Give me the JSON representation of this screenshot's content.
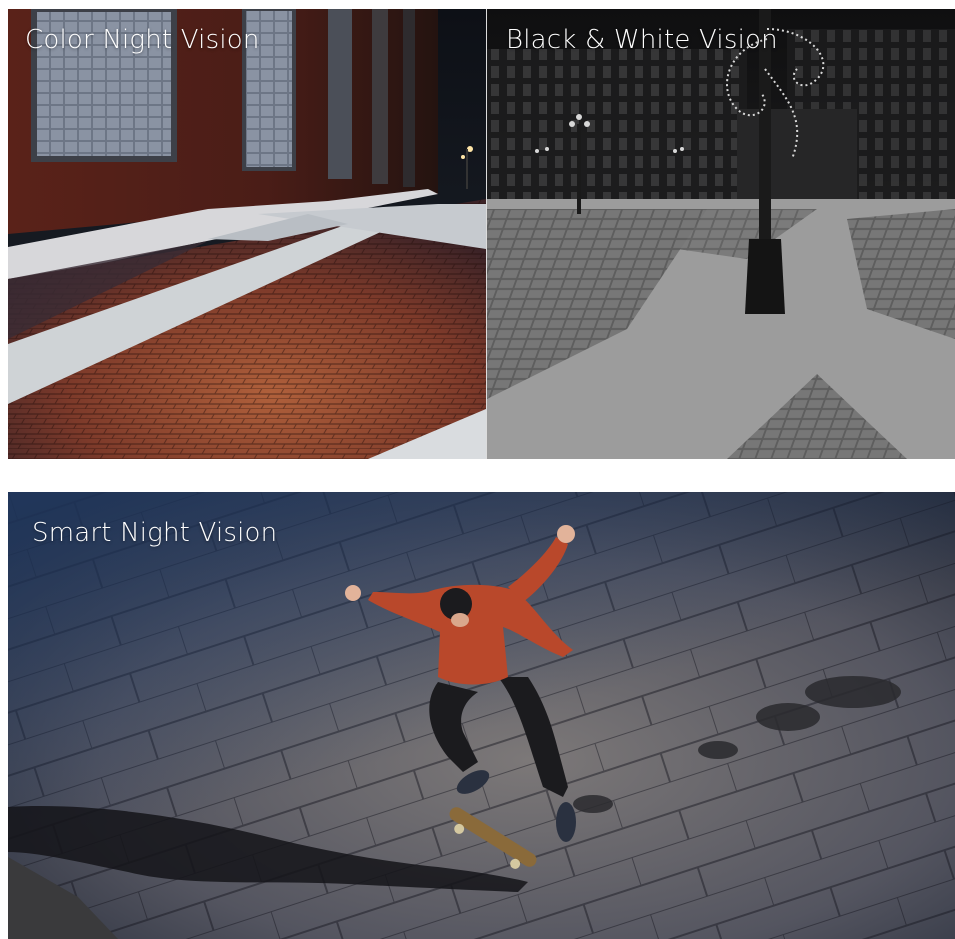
{
  "panels": {
    "color_night": {
      "label": "Color Night Vision"
    },
    "bw": {
      "label": "Black & White Vision"
    },
    "smart_night": {
      "label": "Smart Night Vision"
    }
  },
  "colors": {
    "background": "#ffffff",
    "label_text": "#ffffff",
    "brick_wall": "#6a2a20",
    "brick_pavement": "#8e4a32",
    "night_sky": "#1c2330",
    "bw_pavement": "#8a8a8a",
    "smart_floor": "#6b6a6e",
    "jacket": "#b9482b"
  }
}
